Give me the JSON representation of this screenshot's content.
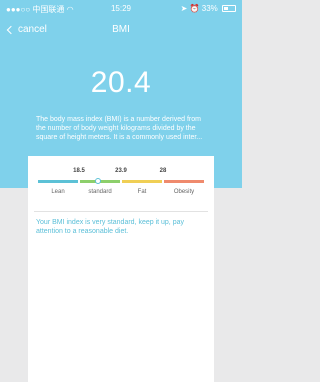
{
  "status_bar": {
    "carrier": "中国联通",
    "time": "15:29",
    "battery": "33%"
  },
  "nav": {
    "back_label": "cancel",
    "title": "BMI"
  },
  "bmi": {
    "value": "20.4",
    "value_number": 20.4,
    "description": "The body mass index (BMI) is a number derived from the number of body weight kilograms divided by the square of height meters. It is a commonly used inter..."
  },
  "scale": {
    "thresholds": [
      "18.5",
      "23.9",
      "28"
    ],
    "categories": [
      "Lean",
      "standard",
      "Fat",
      "Obesity"
    ],
    "colors": [
      "#5cc1d6",
      "#8dcf6b",
      "#f0cf55",
      "#ef8a6d"
    ],
    "marker_position_fraction": 0.36
  },
  "advice": {
    "text": "Your BMI index is very standard, keep it up, pay attention to a reasonable diet."
  },
  "colors": {
    "header_bg": "#7fd1eb",
    "accent_text": "#5bbfd8",
    "page_bg": "#e9e9ea"
  }
}
